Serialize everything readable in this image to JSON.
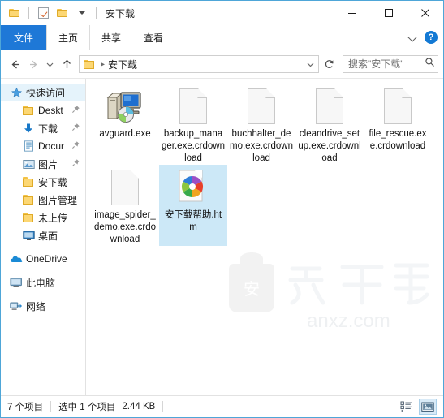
{
  "window": {
    "title": "安下载",
    "quick_access": [
      {
        "name": "folder-icon",
        "label": "文件夹"
      },
      {
        "name": "properties-icon",
        "label": "属性"
      },
      {
        "name": "folder-icon",
        "label": "新建文件夹"
      },
      {
        "name": "chevron-down-icon",
        "label": "自定义快速访问工具栏"
      }
    ],
    "controls": {
      "minimize": "—",
      "maximize": "□",
      "close": "✕"
    }
  },
  "ribbon": {
    "tabs": [
      {
        "label": "文件",
        "active": false,
        "file_menu": true
      },
      {
        "label": "主页",
        "active": true,
        "file_menu": false
      },
      {
        "label": "共享",
        "active": false,
        "file_menu": false
      },
      {
        "label": "查看",
        "active": false,
        "file_menu": false
      }
    ],
    "expand_label": "展开功能区",
    "help_label": "?"
  },
  "address": {
    "back_label": "后退",
    "forward_label": "前进",
    "recent_label": "最近浏览的位置",
    "up_label": "上移到",
    "breadcrumb": [
      "安下载"
    ],
    "dropdown_label": "历史记录",
    "refresh_label": "刷新",
    "search_placeholder": "搜索\"安下载\"",
    "search_value": ""
  },
  "sidebar": {
    "items": [
      {
        "label": "快速访问",
        "icon": "star-icon",
        "level": 1,
        "selected": true,
        "pinned": false
      },
      {
        "label": "Deskt",
        "icon": "folder-icon",
        "level": 2,
        "selected": false,
        "pinned": true
      },
      {
        "label": "下载",
        "icon": "download-arrow-icon",
        "level": 2,
        "selected": false,
        "pinned": true
      },
      {
        "label": "Docur",
        "icon": "document-icon",
        "level": 2,
        "selected": false,
        "pinned": true
      },
      {
        "label": "图片",
        "icon": "picture-icon",
        "level": 2,
        "selected": false,
        "pinned": true
      },
      {
        "label": "安下载",
        "icon": "folder-icon",
        "level": 2,
        "selected": false,
        "pinned": false
      },
      {
        "label": "图片管理",
        "icon": "folder-icon",
        "level": 2,
        "selected": false,
        "pinned": false
      },
      {
        "label": "未上传",
        "icon": "folder-icon",
        "level": 2,
        "selected": false,
        "pinned": false
      },
      {
        "label": "桌面",
        "icon": "desktop-icon",
        "level": 2,
        "selected": false,
        "pinned": false
      },
      {
        "label": "OneDrive",
        "icon": "cloud-icon",
        "level": 1,
        "selected": false,
        "pinned": false
      },
      {
        "label": "此电脑",
        "icon": "computer-icon",
        "level": 1,
        "selected": false,
        "pinned": false
      },
      {
        "label": "网络",
        "icon": "network-icon",
        "level": 1,
        "selected": false,
        "pinned": false
      }
    ]
  },
  "files": [
    {
      "name": "avguard.exe",
      "icon": "setup-installer-icon",
      "selected": false
    },
    {
      "name": "backup_manager.exe.crdownload",
      "icon": "blank-document-icon",
      "selected": false
    },
    {
      "name": "buchhalter_demo.exe.crdownload",
      "icon": "blank-document-icon",
      "selected": false
    },
    {
      "name": "cleandrive_setup.exe.crdownload",
      "icon": "blank-document-icon",
      "selected": false
    },
    {
      "name": "file_rescue.exe.crdownload",
      "icon": "blank-document-icon",
      "selected": false
    },
    {
      "name": "image_spider_demo.exe.crdownload",
      "icon": "blank-document-icon",
      "selected": false
    },
    {
      "name": "安下载帮助.htm",
      "icon": "chrome-html-icon",
      "selected": true
    }
  ],
  "watermark": {
    "brand": "安下载",
    "domain": "anxz.com",
    "badge": "安"
  },
  "statusbar": {
    "item_count": "7 个项目",
    "selection": "选中 1 个项目",
    "size": "2.44 KB",
    "views": [
      {
        "name": "details-view-button",
        "label": "详细信息",
        "active": false
      },
      {
        "name": "large-icons-view-button",
        "label": "大图标",
        "active": true
      }
    ]
  },
  "colors": {
    "accent": "#1e78d7",
    "selection": "#cce8f7",
    "nav_selected": "#e5f3fb",
    "border": "#4ea6d8"
  }
}
